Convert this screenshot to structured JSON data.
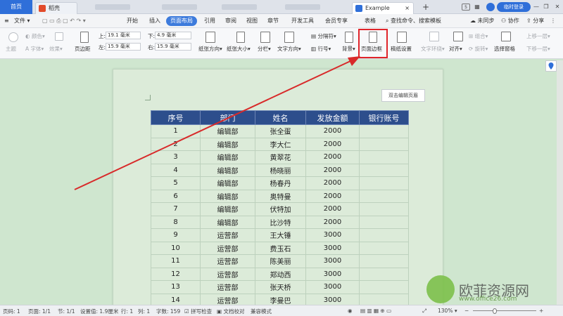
{
  "titlebar": {
    "home_tab": "首页",
    "doc_tab": "稻壳",
    "example_tab": "Example",
    "login": "临时登录"
  },
  "menubar": {
    "file": "文件",
    "items": [
      "开始",
      "插入",
      "页面布局",
      "引用",
      "审阅",
      "视图",
      "章节",
      "开发工具",
      "会员专享",
      "表格"
    ],
    "search": "查找命令、搜索模板",
    "sync": "未同步",
    "collab": "协作",
    "share": "分享"
  },
  "ribbon": {
    "theme": "主题",
    "color": "颜色",
    "font": "字体",
    "effect": "效果",
    "margin": "页边距",
    "top_label": "上:",
    "top_val": "19.1 毫米",
    "bottom_label": "下:",
    "bottom_val": "4.9 毫米",
    "left_label": "左:",
    "left_val": "15.9 毫米",
    "right_label": "右:",
    "right_val": "15.9 毫米",
    "orientation": "纸张方向",
    "size": "纸张大小",
    "columns": "分栏",
    "text_dir": "文字方向",
    "breaks": "分隔符",
    "line_no": "行号",
    "background": "背景",
    "page_border": "页面边框",
    "draft": "稿纸设置",
    "wrap": "文字环绕",
    "align": "对齐",
    "rotate": "旋转",
    "select_pane": "选择窗格",
    "group": "组合",
    "up_layer": "上移一层",
    "down_layer": "下移一层"
  },
  "document": {
    "header_hint": "双击编辑页眉",
    "headers": [
      "序号",
      "部门",
      "姓名",
      "发放金额",
      "银行账号"
    ],
    "rows": [
      [
        "1",
        "编辑部",
        "张全蛋",
        "2000",
        ""
      ],
      [
        "2",
        "编辑部",
        "李大仁",
        "2000",
        ""
      ],
      [
        "3",
        "编辑部",
        "黄翠花",
        "2000",
        ""
      ],
      [
        "4",
        "编辑部",
        "杨晓丽",
        "2000",
        ""
      ],
      [
        "5",
        "编辑部",
        "杨春丹",
        "2000",
        ""
      ],
      [
        "6",
        "编辑部",
        "奥特曼",
        "2000",
        ""
      ],
      [
        "7",
        "编辑部",
        "伏特加",
        "2000",
        ""
      ],
      [
        "8",
        "编辑部",
        "比沙特",
        "2000",
        ""
      ],
      [
        "9",
        "运营部",
        "王大锤",
        "3000",
        ""
      ],
      [
        "10",
        "运营部",
        "费玉石",
        "3000",
        ""
      ],
      [
        "11",
        "运营部",
        "陈美丽",
        "3000",
        ""
      ],
      [
        "12",
        "运营部",
        "郑动西",
        "3000",
        ""
      ],
      [
        "13",
        "运营部",
        "张天桥",
        "3000",
        ""
      ],
      [
        "14",
        "运营部",
        "李曼巴",
        "3000",
        ""
      ]
    ]
  },
  "statusbar": {
    "page_no": "页码: 1",
    "pages": "页面: 1/1",
    "section": "节: 1/1",
    "setting": "设置值: 1.9厘米",
    "row": "行: 1",
    "col": "列: 1",
    "words": "字数: 159",
    "spell": "拼写检查",
    "proof": "文档校对",
    "compat": "兼容模式",
    "zoom": "130%"
  },
  "watermark": {
    "brand": "欧菲资源网",
    "url": "www.office26.com"
  },
  "colors": {
    "accent": "#2f6fd9",
    "table_header": "#2d4e8c",
    "highlight": "#e0242a",
    "doc_bg": "#cfe6cf"
  }
}
